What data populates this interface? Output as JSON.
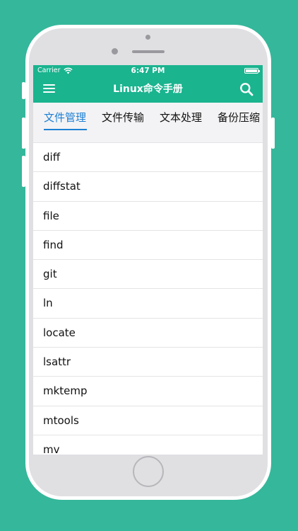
{
  "status": {
    "carrier": "Carrier",
    "time": "6:47 PM"
  },
  "navbar": {
    "title": "Linux命令手册",
    "menu_icon": "hamburger-icon",
    "search_icon": "search-icon"
  },
  "tabs": [
    {
      "label": "文件管理",
      "active": true
    },
    {
      "label": "文件传输",
      "active": false
    },
    {
      "label": "文本处理",
      "active": false
    },
    {
      "label": "备份压缩",
      "active": false
    }
  ],
  "commands": [
    "diff",
    "diffstat",
    "file",
    "find",
    "git",
    "ln",
    "locate",
    "lsattr",
    "mktemp",
    "mtools",
    "mv"
  ],
  "colors": {
    "background": "#35b79b",
    "header": "#1ab48f",
    "active_tab": "#1d7fd3"
  }
}
